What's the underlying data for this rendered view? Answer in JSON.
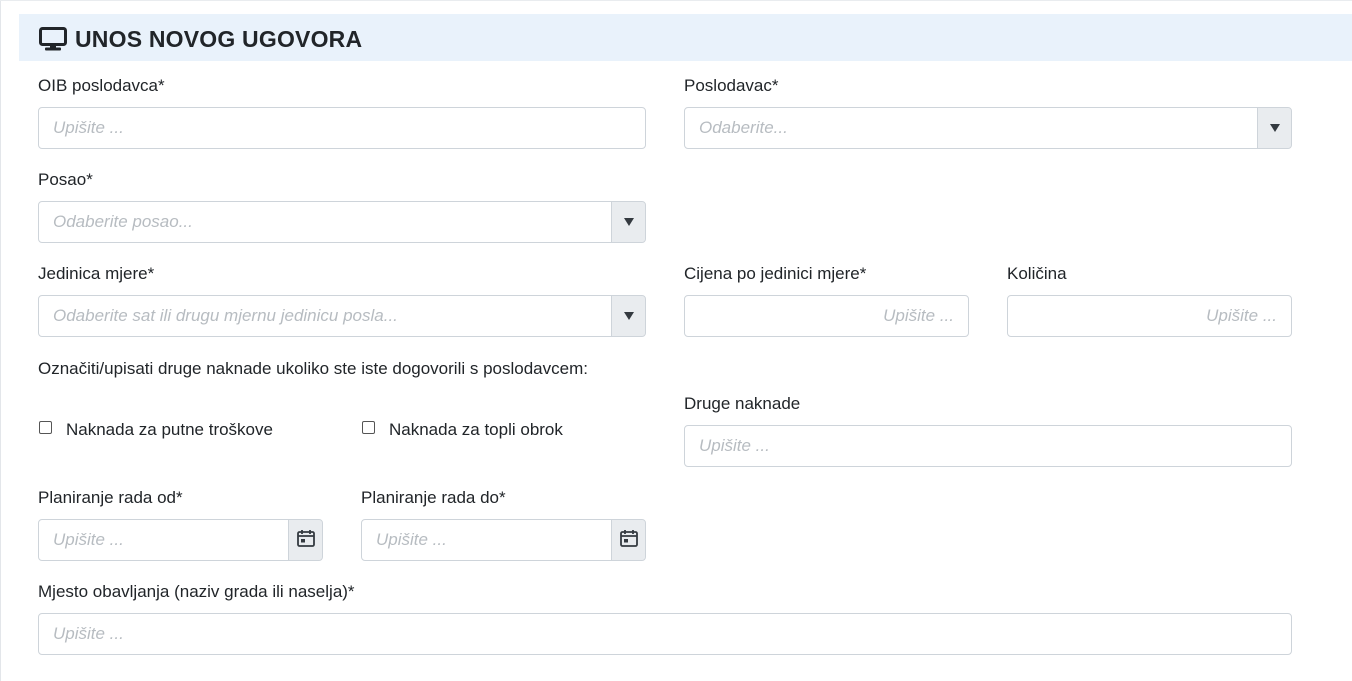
{
  "header": {
    "title": "UNOS NOVOG UGOVORA",
    "icon": "monitor-icon"
  },
  "fields": {
    "oib": {
      "label": "OIB poslodavca*",
      "placeholder": "Upišite ..."
    },
    "poslodavac": {
      "label": "Poslodavac*",
      "placeholder": "Odaberite..."
    },
    "posao": {
      "label": "Posao*",
      "placeholder": "Odaberite posao..."
    },
    "jedinica": {
      "label": "Jedinica mjere*",
      "placeholder": "Odaberite sat ili drugu mjernu jedinicu posla..."
    },
    "cijena": {
      "label": "Cijena po jedinici mjere*",
      "placeholder": "Upišite ..."
    },
    "kolicina": {
      "label": "Količina",
      "placeholder": "Upišite ..."
    },
    "naknade_intro": "Označiti/upisati druge naknade ukoliko ste iste dogovorili s poslodavcem:",
    "putni": {
      "label": "Naknada za putne troškove",
      "checked": false
    },
    "obrok": {
      "label": "Naknada za topli obrok",
      "checked": false
    },
    "druge": {
      "label": "Druge naknade",
      "placeholder": "Upišite ..."
    },
    "od": {
      "label": "Planiranje rada od*",
      "placeholder": "Upišite ..."
    },
    "do": {
      "label": "Planiranje rada do*",
      "placeholder": "Upišite ..."
    },
    "mjesto": {
      "label": "Mjesto obavljanja (naziv grada ili naselja)*",
      "placeholder": "Upišite ..."
    }
  }
}
